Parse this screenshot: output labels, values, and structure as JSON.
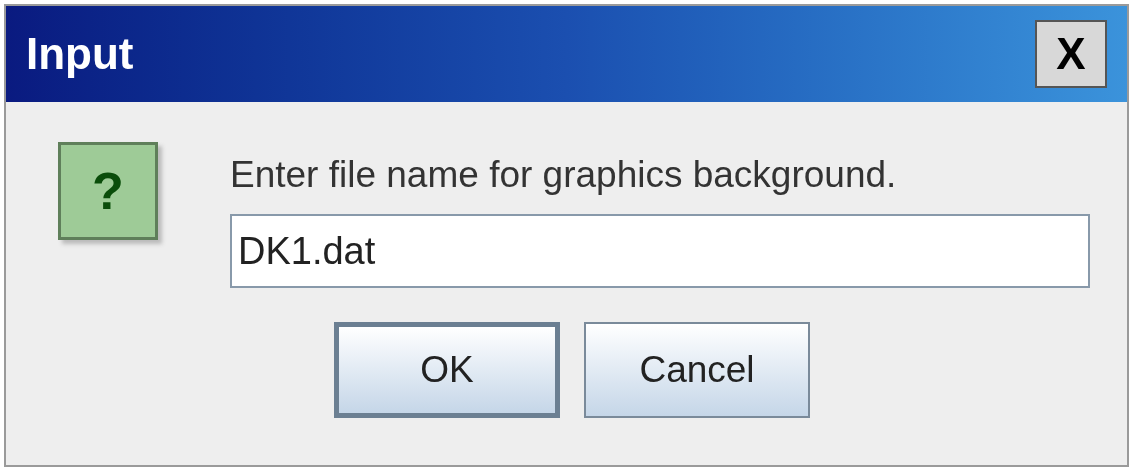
{
  "window": {
    "title": "Input",
    "close": "X"
  },
  "icon": {
    "glyph": "?"
  },
  "message": "Enter file name for graphics background.",
  "input": {
    "value": "DK1.dat"
  },
  "buttons": [
    {
      "label": "OK",
      "default": true
    },
    {
      "label": "Cancel",
      "default": false
    }
  ]
}
